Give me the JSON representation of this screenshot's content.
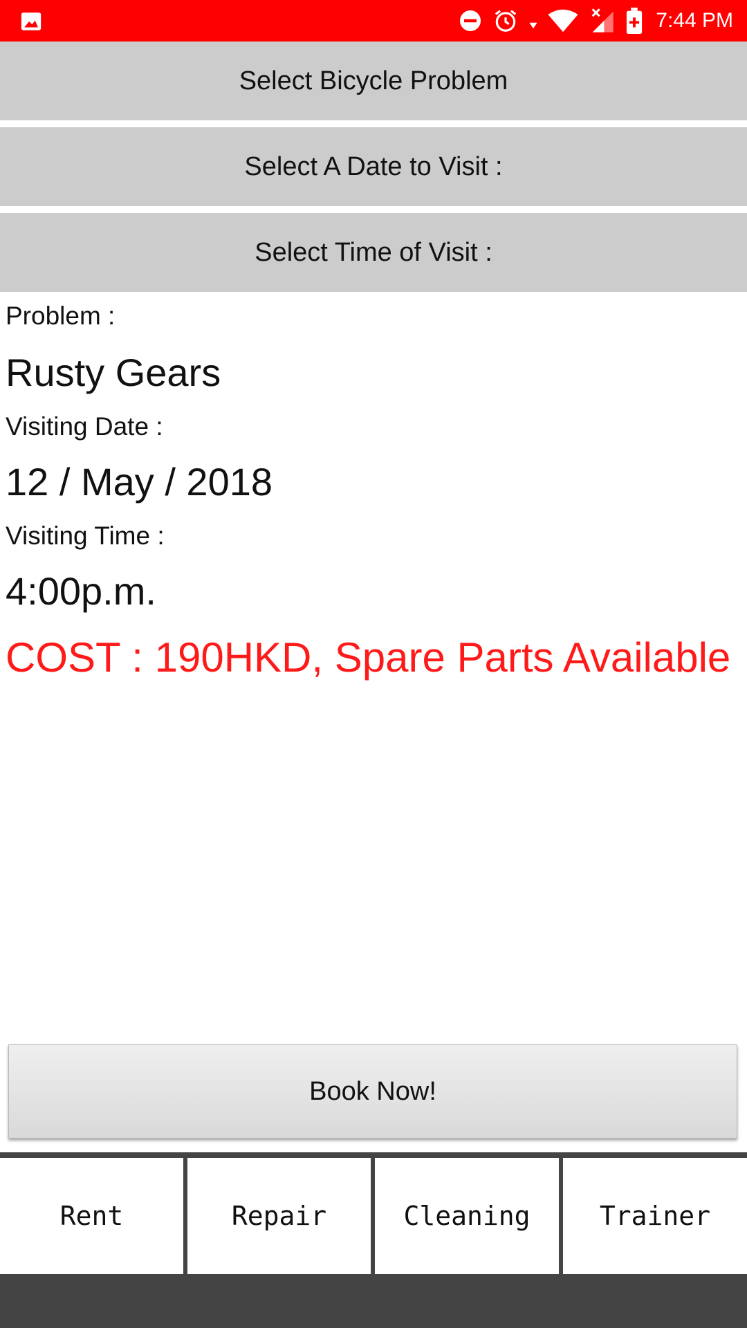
{
  "status_bar": {
    "time": "7:44 PM",
    "icons": [
      "image-icon",
      "do-not-disturb-icon",
      "alarm-icon",
      "wifi-icon",
      "signal-icon",
      "battery-icon"
    ],
    "color": "#ff0000"
  },
  "selectors": {
    "problem_label": "Select Bicycle Problem",
    "date_label": "Select A Date to Visit :",
    "time_label": "Select Time of Visit :"
  },
  "details": {
    "problem_label": "Problem :",
    "problem_value": "Rusty Gears",
    "date_label": "Visiting Date :",
    "date_value": "12 / May / 2018",
    "time_label": "Visiting Time :",
    "time_value": "4:00p.m.",
    "cost_text": "COST : 190HKD, Spare Parts Available",
    "cost_color": "#ff1a1a"
  },
  "book_button": {
    "label": "Book Now!"
  },
  "tabs": [
    {
      "label": "Rent"
    },
    {
      "label": "Repair"
    },
    {
      "label": "Cleaning"
    },
    {
      "label": "Trainer"
    }
  ]
}
